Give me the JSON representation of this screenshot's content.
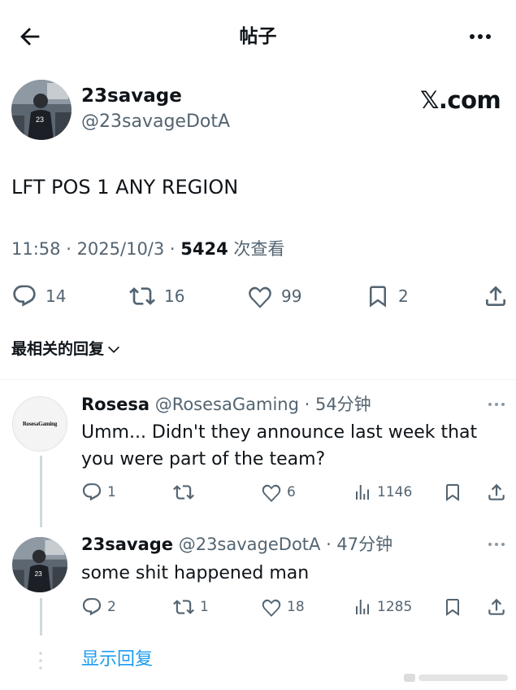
{
  "header": {
    "title": "帖子",
    "back_icon": "arrow-left-icon",
    "more_icon": "more-horizontal-icon"
  },
  "post": {
    "author_name": "23savage",
    "author_handle": "@23savageDotA",
    "brand": "𝕏.com",
    "text": "LFT POS 1 ANY REGION",
    "time": "11:58",
    "sep1": " · ",
    "date": "2025/10/3",
    "sep2": " · ",
    "views": "5424",
    "views_label": " 次查看",
    "replies": "14",
    "reposts": "16",
    "likes": "99",
    "bookmarks": "2"
  },
  "sort_label": "最相关的回复",
  "replies": [
    {
      "name": "Rosesa",
      "handle": " @RosesaGaming",
      "time": " · 54分钟",
      "avatar_text": "RosesaGaming",
      "text": "Umm... Didn't they announce last week that you were part of the team?",
      "replies": "1",
      "reposts": "",
      "likes": "6",
      "views": "1146"
    },
    {
      "name": "23savage",
      "handle": " @23savageDotA",
      "time": " · 47分钟",
      "text": "some shit happened man",
      "replies": "2",
      "reposts": "1",
      "likes": "18",
      "views": "1285"
    }
  ],
  "show_replies_label": "显示回复",
  "colors": {
    "text": "#0f1419",
    "secondary": "#536471",
    "link": "#1d9bf0",
    "divider": "#eff3f4"
  }
}
